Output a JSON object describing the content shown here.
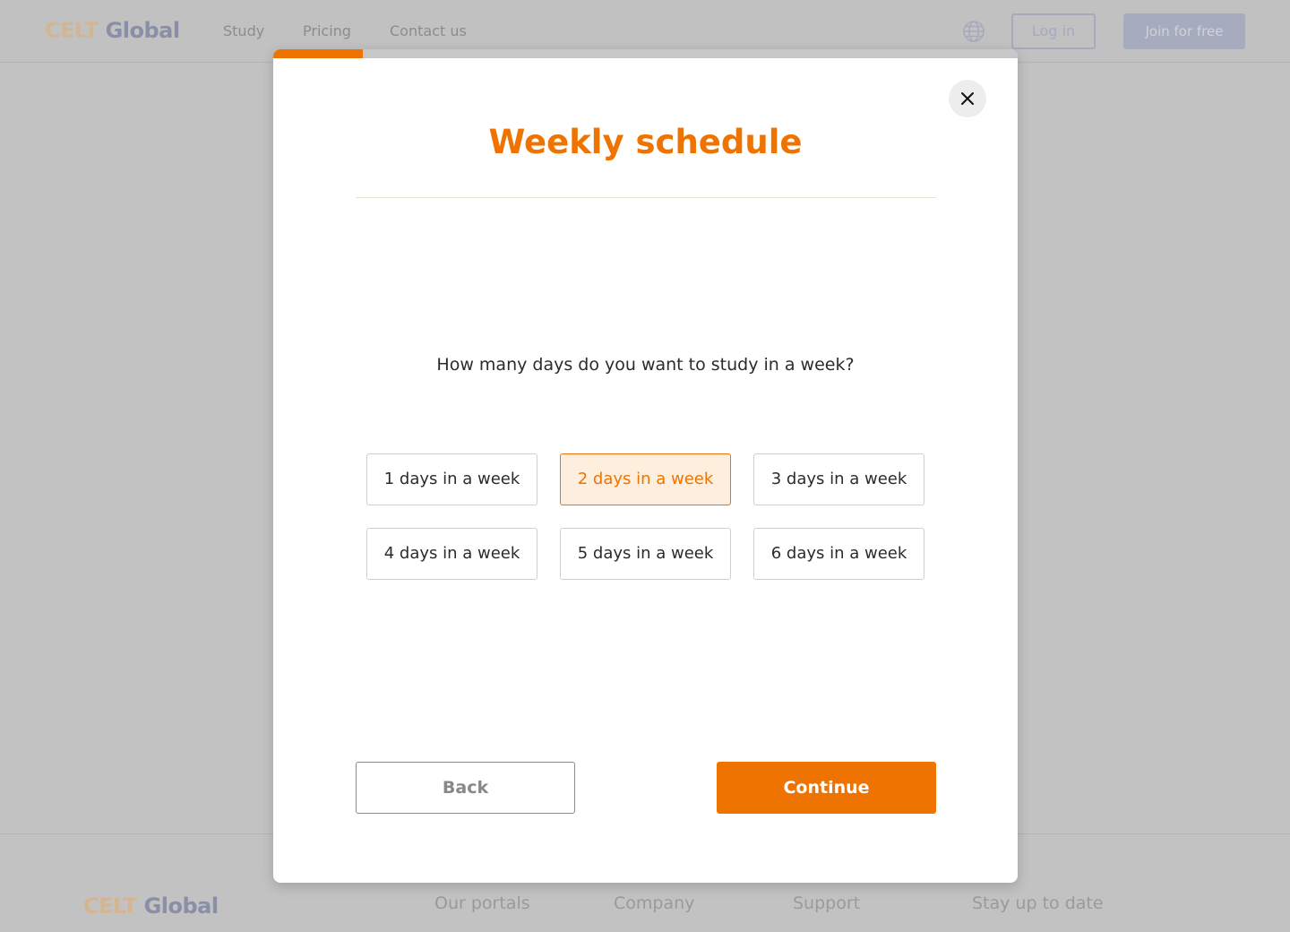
{
  "header": {
    "logo": {
      "part1": "CELT",
      "part2": "Global"
    },
    "nav": [
      "Study",
      "Pricing",
      "Contact us"
    ],
    "language_icon": "globe-icon",
    "login_label": "Log in",
    "join_label": "Join for free"
  },
  "footer": {
    "logo": {
      "part1": "CELT",
      "part2": "Global"
    },
    "columns": [
      "Our portals",
      "Company",
      "Support",
      "Stay up to date"
    ]
  },
  "modal": {
    "progress_percent": 12,
    "close_icon": "close-icon",
    "title": "Weekly schedule",
    "question": "How many days do you want to study in a week?",
    "options": [
      "1 days in a week",
      "2 days in a week",
      "3 days in a week",
      "4 days in a week",
      "5 days in a week",
      "6 days in a week"
    ],
    "selected_index": 1,
    "back_label": "Back",
    "continue_label": "Continue"
  },
  "colors": {
    "accent": "#ef7300",
    "selected_bg": "#fdeedd",
    "overlay": "#c2c2c2"
  }
}
